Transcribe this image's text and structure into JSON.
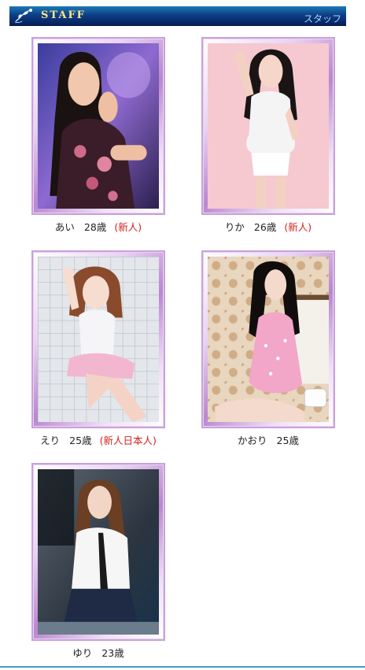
{
  "header": {
    "title": "STAFF",
    "subtitle": "スタッフ"
  },
  "staff": [
    {
      "name": "あい",
      "age": "28歳",
      "tag": "(新人)"
    },
    {
      "name": "りか",
      "age": "26歳",
      "tag": "(新人)"
    },
    {
      "name": "えり",
      "age": "25歳",
      "tag": "(新人日本人)"
    },
    {
      "name": "かおり",
      "age": "25歳",
      "tag": ""
    },
    {
      "name": "ゆり",
      "age": "23歳",
      "tag": ""
    }
  ]
}
